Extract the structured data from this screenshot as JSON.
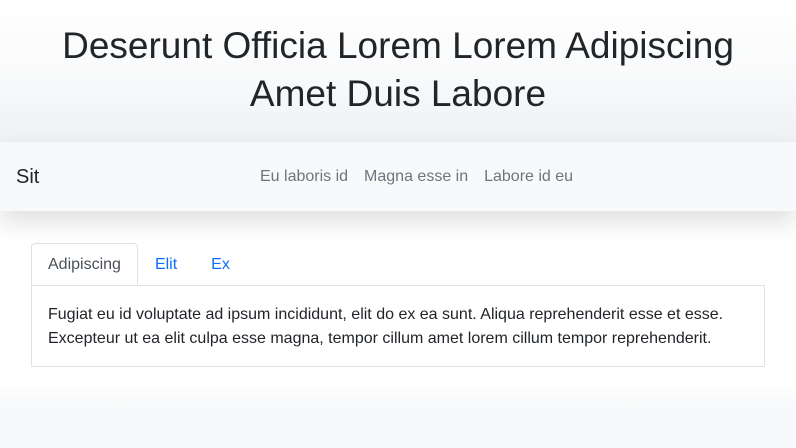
{
  "header": {
    "title": "Deserunt Officia Lorem Lorem Adipiscing Amet Duis Labore"
  },
  "navbar": {
    "brand": "Sit",
    "links": [
      {
        "label": "Eu laboris id"
      },
      {
        "label": "Magna esse in"
      },
      {
        "label": "Labore id eu"
      }
    ]
  },
  "tabs": {
    "items": [
      {
        "label": "Adipiscing",
        "active": true
      },
      {
        "label": "Elit",
        "active": false
      },
      {
        "label": "Ex",
        "active": false
      }
    ],
    "content": "Fugiat eu id voluptate ad ipsum incididunt, elit do ex ea sunt. Aliqua reprehenderit esse et esse. Excepteur ut ea elit culpa esse magna, tempor cillum amet lorem cillum tempor reprehenderit."
  },
  "colors": {
    "link": "#0d6efd",
    "muted": "#6c757d",
    "text": "#212529",
    "border": "#dee2e6",
    "background": "#f8f9fa"
  }
}
